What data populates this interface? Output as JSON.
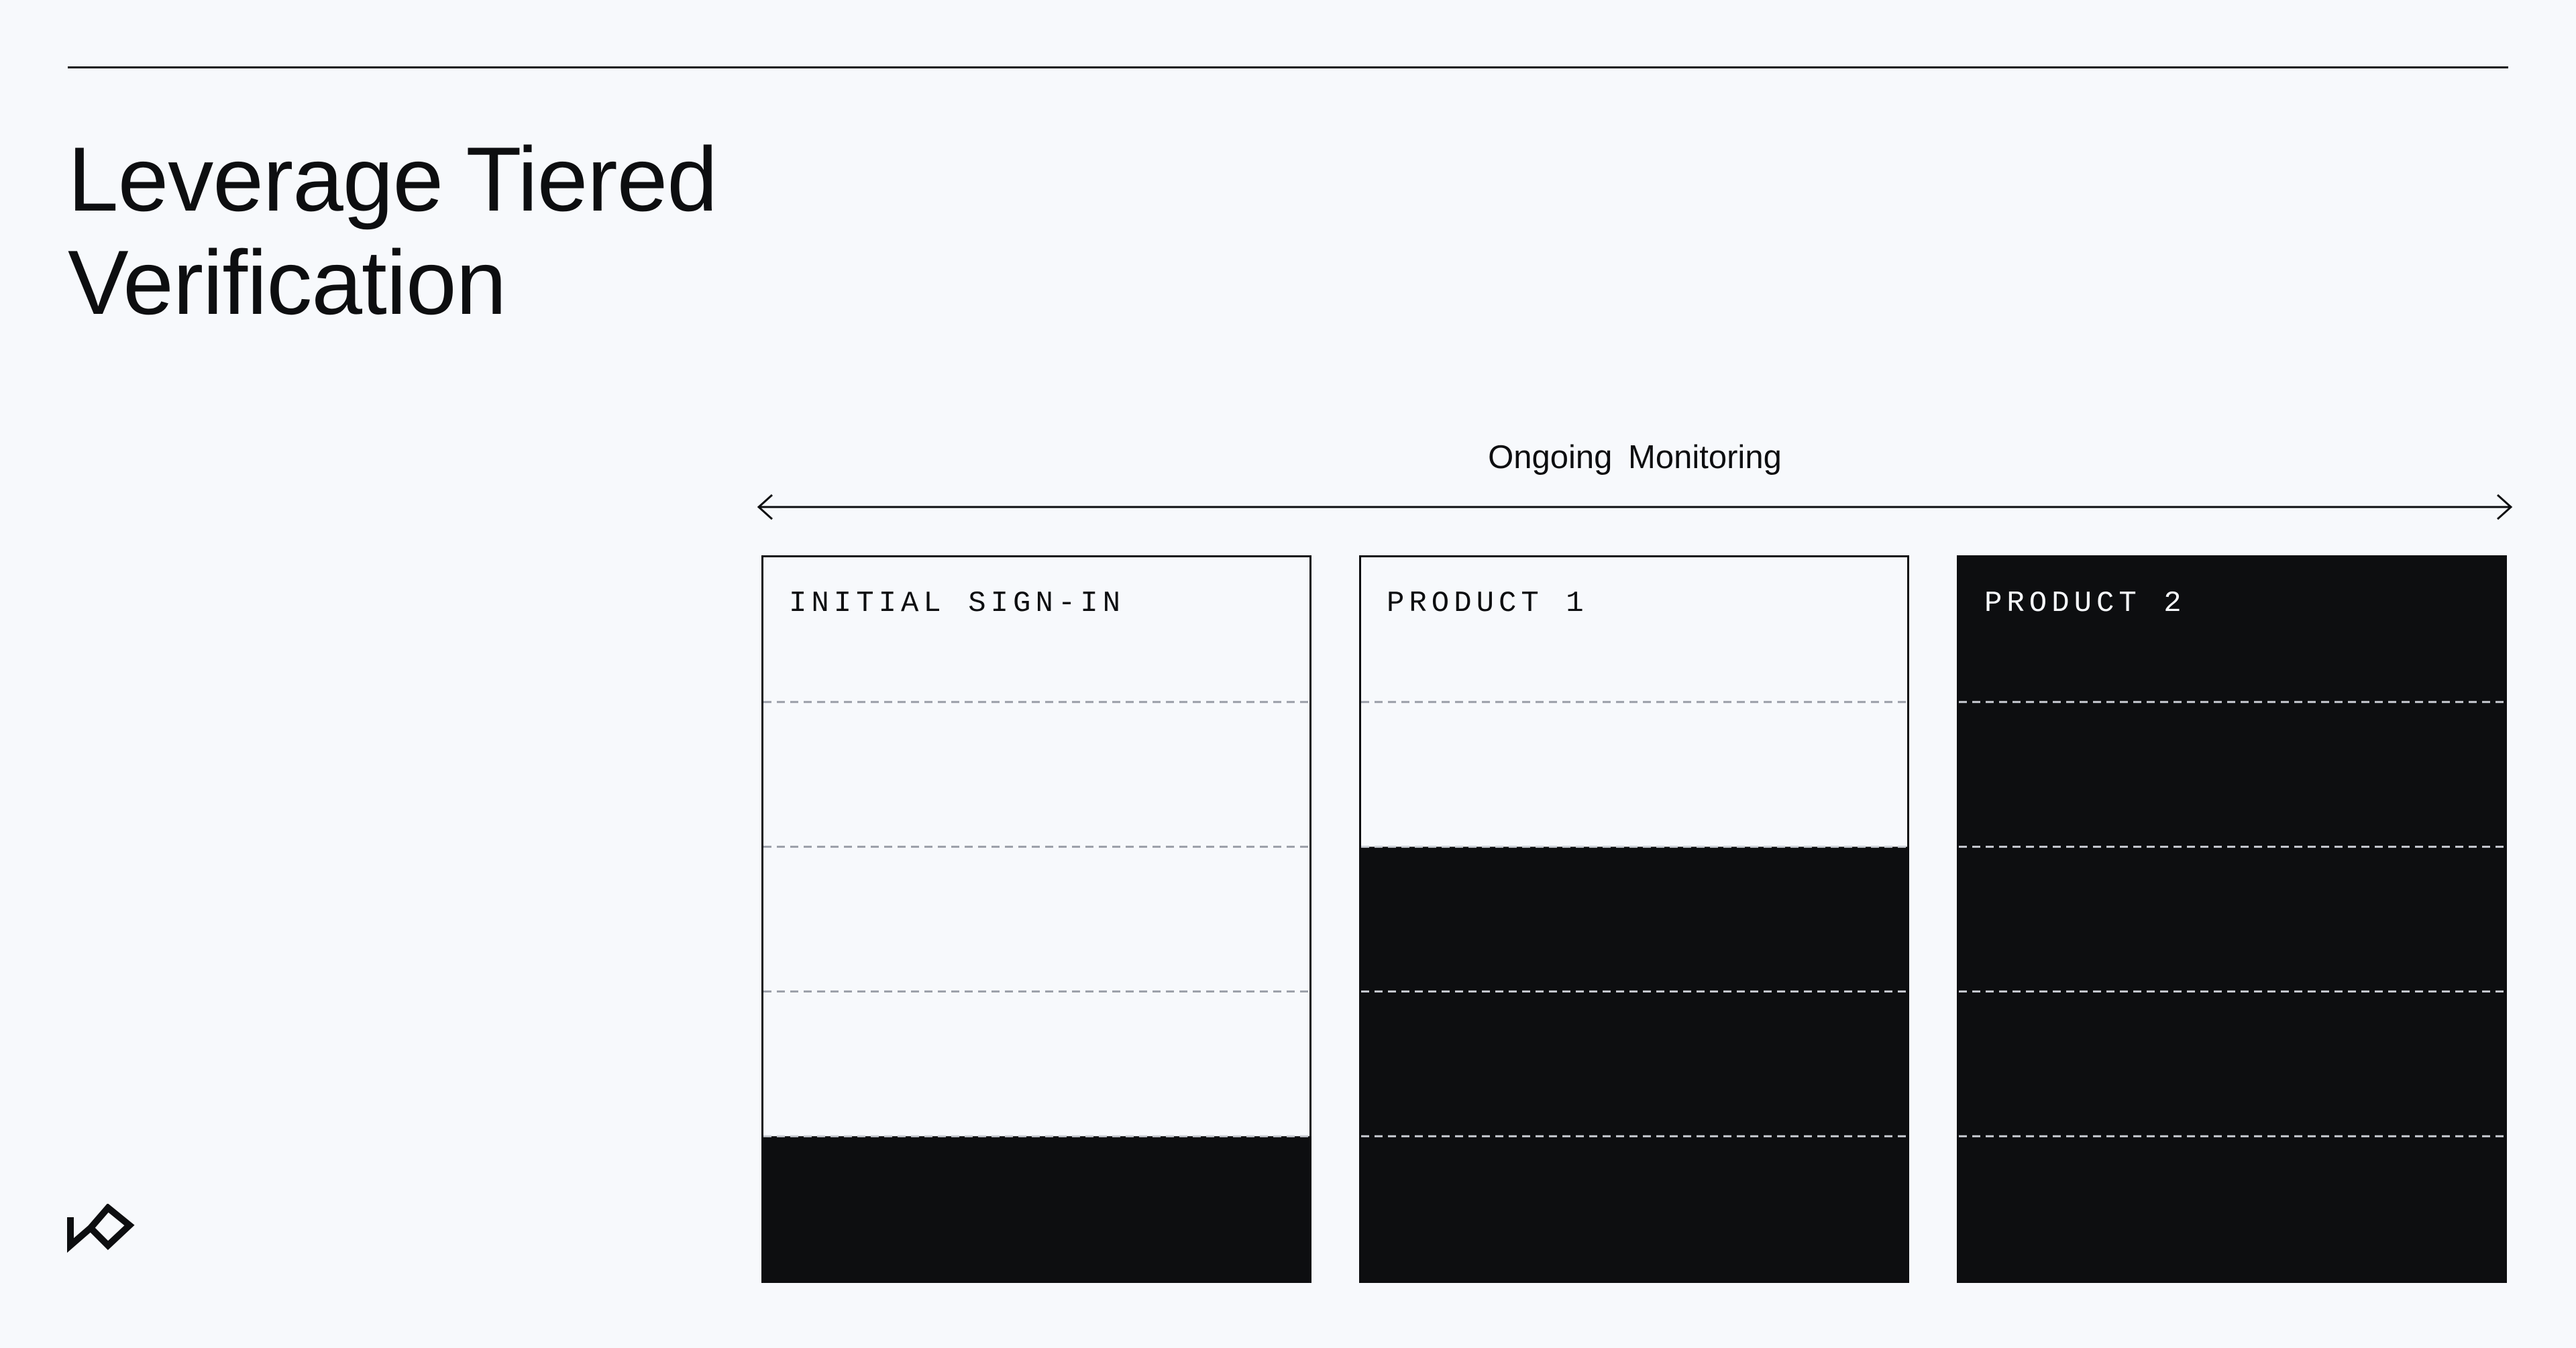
{
  "slide": {
    "title_line1": "Leverage Tiered",
    "title_line2": "Verification"
  },
  "monitoring": {
    "label": "Ongoing  Monitoring"
  },
  "tiers": [
    {
      "label": "INITIAL SIGN-IN",
      "filled_levels": 1
    },
    {
      "label": "PRODUCT 1",
      "filled_levels": 3
    },
    {
      "label": "PRODUCT 2",
      "filled_levels": 5
    }
  ],
  "tier_levels_total": 5,
  "colors": {
    "background": "#f7f9fc",
    "ink": "#0d0e10",
    "dash_light": "#9a9ea8",
    "dash_dark": "#c9ccd3"
  },
  "icons": {
    "brand_logo": "brand-logo-icon",
    "arrow": "double-headed-arrow-icon"
  }
}
